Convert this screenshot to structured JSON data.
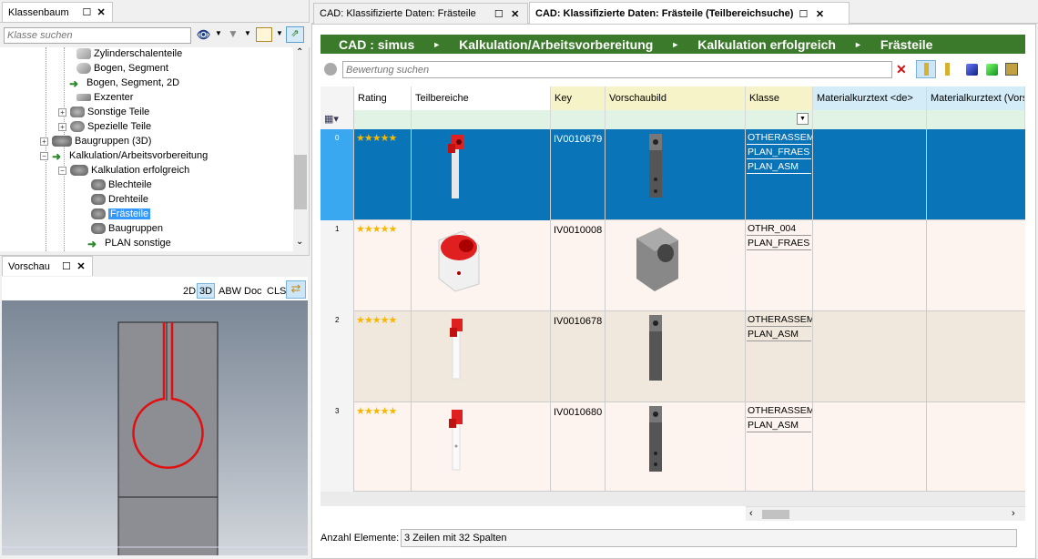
{
  "left_panel": {
    "title": "Klassenbaum",
    "search_placeholder": "Klasse suchen",
    "tree": [
      {
        "label": "Zylinderschalenteile"
      },
      {
        "label": "Bogen, Segment"
      },
      {
        "label": "Bogen, Segment, 2D"
      },
      {
        "label": "Exzenter"
      },
      {
        "label": "Sonstige Teile"
      },
      {
        "label": "Spezielle Teile"
      },
      {
        "label": "Baugruppen (3D)"
      },
      {
        "label": "Kalkulation/Arbeitsvorbereitung"
      },
      {
        "label": "Kalkulation erfolgreich"
      },
      {
        "label": "Blechteile"
      },
      {
        "label": "Drehteile"
      },
      {
        "label": "Frästeile"
      },
      {
        "label": "Baugruppen"
      },
      {
        "label": "PLAN sonstige"
      }
    ]
  },
  "preview_panel": {
    "title": "Vorschau",
    "buttons": [
      "2D",
      "3D",
      "ABW",
      "Doc",
      "CLS"
    ]
  },
  "tabs": [
    {
      "label": "CAD: Klassifizierte Daten: Frästeile"
    },
    {
      "label": "CAD: Klassifizierte Daten: Frästeile (Teilbereichsuche)"
    }
  ],
  "breadcrumb": [
    "CAD : simus",
    "Kalkulation/Arbeitsvorbereitung",
    "Kalkulation erfolgreich",
    "Frästeile"
  ],
  "breadcrumb_sep": "►",
  "search": {
    "placeholder": "Bewertung suchen"
  },
  "columns": [
    "Rating",
    "Teilbereiche",
    "Key",
    "Vorschaubild",
    "Klasse",
    "Materialkurztext <de>",
    "Materialkurztext (Vors"
  ],
  "rows": [
    {
      "num": "0",
      "stars": "★★★★★",
      "key": "IV0010679",
      "klasse": [
        "OTHERASSEM",
        "PLAN_FRAES",
        "PLAN_ASM"
      ]
    },
    {
      "num": "1",
      "stars": "★★★★★",
      "key": "IV0010008",
      "klasse": [
        "OTHR_004",
        "PLAN_FRAES"
      ]
    },
    {
      "num": "2",
      "stars": "★★★★★",
      "key": "IV0010678",
      "klasse": [
        "OTHERASSEM",
        "PLAN_ASM"
      ]
    },
    {
      "num": "3",
      "stars": "★★★★★",
      "key": "IV0010680",
      "klasse": [
        "OTHERASSEM",
        "PLAN_ASM"
      ]
    }
  ],
  "status": {
    "label": "Anzahl Elemente:",
    "value": "3 Zeilen mit 32 Spalten"
  },
  "colors": {
    "green_bar": "#3b7a2a",
    "selected_row": "#0a74b8",
    "row_alt": "#f0e8dc",
    "row_light": "#fdf4ef"
  }
}
